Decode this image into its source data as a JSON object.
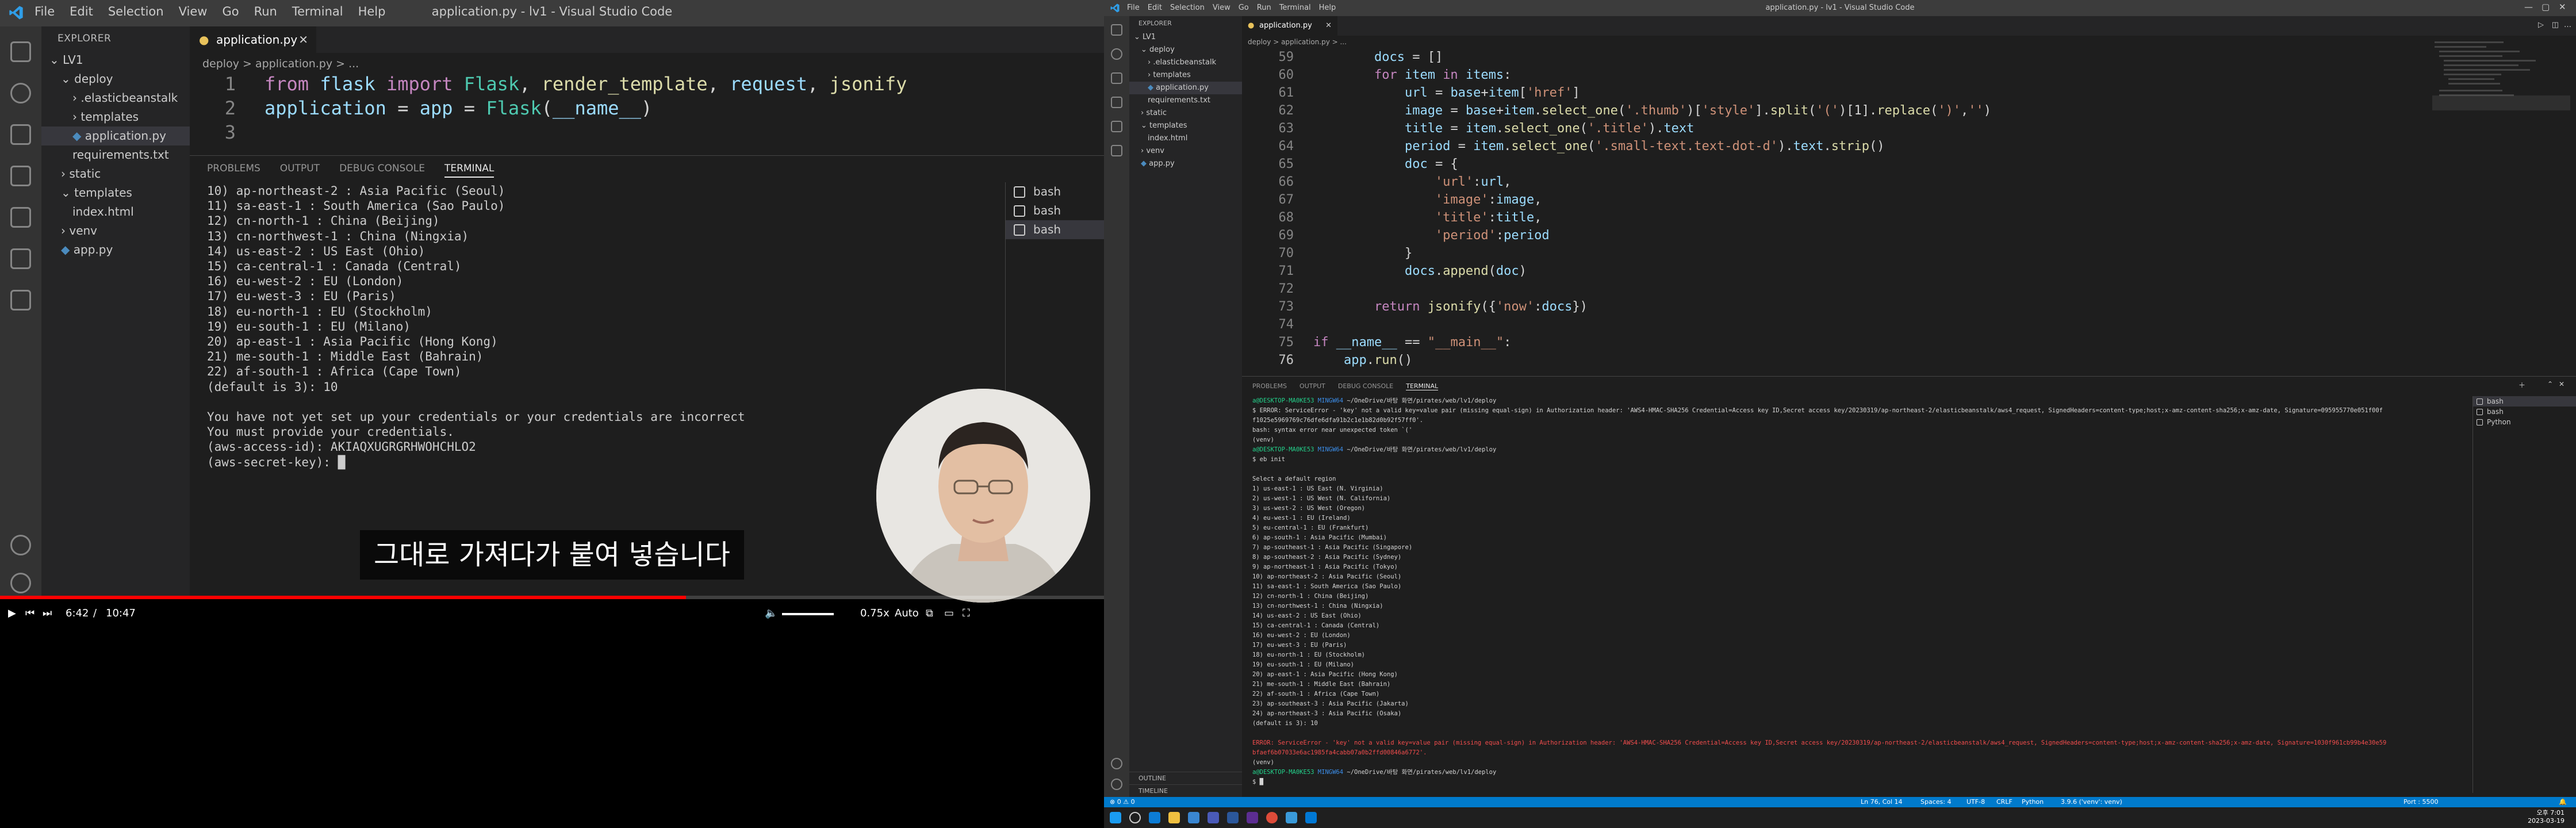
{
  "video": {
    "window_title": "application.py - lv1 - Visual Studio Code",
    "menu": [
      "File",
      "Edit",
      "Selection",
      "View",
      "Go",
      "Run",
      "Terminal",
      "Help"
    ],
    "explorer_header": "EXPLORER",
    "explorer": [
      {
        "label": "LV1",
        "indent": 0,
        "arrow": "v",
        "folder": true
      },
      {
        "label": "deploy",
        "indent": 1,
        "arrow": "v",
        "folder": true
      },
      {
        "label": ".elasticbeanstalk",
        "indent": 2,
        "arrow": ">",
        "folder": true
      },
      {
        "label": "templates",
        "indent": 2,
        "arrow": ">",
        "folder": true
      },
      {
        "label": "application.py",
        "indent": 2,
        "arrow": "",
        "folder": false,
        "selected": true
      },
      {
        "label": "requirements.txt",
        "indent": 2,
        "arrow": "",
        "folder": false
      },
      {
        "label": "static",
        "indent": 1,
        "arrow": ">",
        "folder": true
      },
      {
        "label": "templates",
        "indent": 1,
        "arrow": "v",
        "folder": true
      },
      {
        "label": "index.html",
        "indent": 2,
        "arrow": "",
        "folder": false
      },
      {
        "label": "venv",
        "indent": 1,
        "arrow": ">",
        "folder": true
      },
      {
        "label": "app.py",
        "indent": 1,
        "arrow": "",
        "folder": false
      }
    ],
    "tab_label": "application.py",
    "breadcrumb": "deploy  >  application.py  > ...",
    "code": [
      {
        "n": "1",
        "parts": [
          [
            "kw",
            "from "
          ],
          [
            "vr",
            "flask "
          ],
          [
            "kw",
            "import "
          ],
          [
            "tp",
            "Flask"
          ],
          [
            "df",
            ", "
          ],
          [
            "fn",
            "render_template"
          ],
          [
            "df",
            ", "
          ],
          [
            "vr",
            "request"
          ],
          [
            "df",
            ", "
          ],
          [
            "fn",
            "jsonify"
          ]
        ]
      },
      {
        "n": "2",
        "parts": [
          [
            "vr",
            "application "
          ],
          [
            "df",
            "= "
          ],
          [
            "vr",
            "app "
          ],
          [
            "df",
            "= "
          ],
          [
            "tp",
            "Flask"
          ],
          [
            "df",
            "("
          ],
          [
            "vr",
            "__name__"
          ],
          [
            "df",
            ")"
          ]
        ]
      },
      {
        "n": "3",
        "parts": []
      }
    ],
    "panel_tabs": [
      "PROBLEMS",
      "OUTPUT",
      "DEBUG CONSOLE",
      "TERMINAL"
    ],
    "terminal": [
      "10) ap-northeast-2 : Asia Pacific (Seoul)",
      "11) sa-east-1 : South America (Sao Paulo)",
      "12) cn-north-1 : China (Beijing)",
      "13) cn-northwest-1 : China (Ningxia)",
      "14) us-east-2 : US East (Ohio)",
      "15) ca-central-1 : Canada (Central)",
      "16) eu-west-2 : EU (London)",
      "17) eu-west-3 : EU (Paris)",
      "18) eu-north-1 : EU (Stockholm)",
      "19) eu-south-1 : EU (Milano)",
      "20) ap-east-1 : Asia Pacific (Hong Kong)",
      "21) me-south-1 : Middle East (Bahrain)",
      "22) af-south-1 : Africa (Cape Town)",
      "(default is 3): 10",
      "",
      "You have not yet set up your credentials or your credentials are incorrect",
      "You must provide your credentials.",
      "(aws-access-id): AKIAQXUGRGRHWOHCHLO2",
      "(aws-secret-key): █"
    ],
    "shells": [
      "bash",
      "bash",
      "bash"
    ],
    "caption": "그대로 가져다가 붙여 넣습니다",
    "time_current": "6:42",
    "time_sep": "/",
    "time_total": "10:47",
    "speed": "0.75x",
    "quality": "Auto",
    "progress": 0.6213
  },
  "vscode": {
    "window_title": "application.py - lv1 - Visual Studio Code",
    "menu": [
      "File",
      "Edit",
      "Selection",
      "View",
      "Go",
      "Run",
      "Terminal",
      "Help"
    ],
    "explorer_header": "EXPLORER",
    "explorer": [
      {
        "label": "LV1",
        "indent": 0,
        "arrow": "v"
      },
      {
        "label": "deploy",
        "indent": 1,
        "arrow": "v"
      },
      {
        "label": ".elasticbeanstalk",
        "indent": 2,
        "arrow": ">"
      },
      {
        "label": "templates",
        "indent": 2,
        "arrow": ">"
      },
      {
        "label": "application.py",
        "indent": 2,
        "arrow": "",
        "selected": true
      },
      {
        "label": "requirements.txt",
        "indent": 2,
        "arrow": ""
      },
      {
        "label": "static",
        "indent": 1,
        "arrow": ">"
      },
      {
        "label": "templates",
        "indent": 1,
        "arrow": "v"
      },
      {
        "label": "index.html",
        "indent": 2,
        "arrow": ""
      },
      {
        "label": "venv",
        "indent": 1,
        "arrow": ">"
      },
      {
        "label": "app.py",
        "indent": 1,
        "arrow": ""
      }
    ],
    "outline_label": "OUTLINE",
    "timeline_label": "TIMELINE",
    "tab_label": "application.py",
    "breadcrumb": "deploy  >  application.py  > ...",
    "code": [
      {
        "n": "59",
        "parts": [
          [
            "df",
            "        "
          ],
          [
            "vr",
            "docs "
          ],
          [
            "df",
            "= []"
          ]
        ]
      },
      {
        "n": "60",
        "parts": [
          [
            "df",
            "        "
          ],
          [
            "kw",
            "for "
          ],
          [
            "vr",
            "item "
          ],
          [
            "kw",
            "in "
          ],
          [
            "vr",
            "items"
          ],
          [
            "df",
            ":"
          ]
        ]
      },
      {
        "n": "61",
        "parts": [
          [
            "df",
            "            "
          ],
          [
            "vr",
            "url "
          ],
          [
            "df",
            "= "
          ],
          [
            "vr",
            "base"
          ],
          [
            "df",
            "+"
          ],
          [
            "vr",
            "item"
          ],
          [
            "df",
            "["
          ],
          [
            "st",
            "'href'"
          ],
          [
            "df",
            "]"
          ]
        ]
      },
      {
        "n": "62",
        "parts": [
          [
            "df",
            "            "
          ],
          [
            "vr",
            "image "
          ],
          [
            "df",
            "= "
          ],
          [
            "vr",
            "base"
          ],
          [
            "df",
            "+"
          ],
          [
            "vr",
            "item"
          ],
          [
            "df",
            "."
          ],
          [
            "fn",
            "select_one"
          ],
          [
            "df",
            "("
          ],
          [
            "st",
            "'.thumb'"
          ],
          [
            "df",
            ")["
          ],
          [
            "st",
            "'style'"
          ],
          [
            "df",
            "]."
          ],
          [
            "fn",
            "split"
          ],
          [
            "df",
            "("
          ],
          [
            "st",
            "'('"
          ],
          [
            "df",
            ")[1]."
          ],
          [
            "fn",
            "replace"
          ],
          [
            "df",
            "("
          ],
          [
            "st",
            "')'"
          ],
          [
            "df",
            ","
          ],
          [
            "st",
            "''"
          ],
          [
            "df",
            ")"
          ]
        ]
      },
      {
        "n": "63",
        "parts": [
          [
            "df",
            "            "
          ],
          [
            "vr",
            "title "
          ],
          [
            "df",
            "= "
          ],
          [
            "vr",
            "item"
          ],
          [
            "df",
            "."
          ],
          [
            "fn",
            "select_one"
          ],
          [
            "df",
            "("
          ],
          [
            "st",
            "'.title'"
          ],
          [
            "df",
            ")."
          ],
          [
            "vr",
            "text"
          ]
        ]
      },
      {
        "n": "64",
        "parts": [
          [
            "df",
            "            "
          ],
          [
            "vr",
            "period "
          ],
          [
            "df",
            "= "
          ],
          [
            "vr",
            "item"
          ],
          [
            "df",
            "."
          ],
          [
            "fn",
            "select_one"
          ],
          [
            "df",
            "("
          ],
          [
            "st",
            "'.small-text.text-dot-d'"
          ],
          [
            "df",
            ")."
          ],
          [
            "vr",
            "text"
          ],
          [
            "df",
            "."
          ],
          [
            "fn",
            "strip"
          ],
          [
            "df",
            "()"
          ]
        ]
      },
      {
        "n": "65",
        "parts": [
          [
            "df",
            "            "
          ],
          [
            "vr",
            "doc "
          ],
          [
            "df",
            "= {"
          ]
        ]
      },
      {
        "n": "66",
        "parts": [
          [
            "df",
            "                "
          ],
          [
            "st",
            "'url'"
          ],
          [
            "df",
            ":"
          ],
          [
            "vr",
            "url"
          ],
          [
            "df",
            ","
          ]
        ]
      },
      {
        "n": "67",
        "parts": [
          [
            "df",
            "                "
          ],
          [
            "st",
            "'image'"
          ],
          [
            "df",
            ":"
          ],
          [
            "vr",
            "image"
          ],
          [
            "df",
            ","
          ]
        ]
      },
      {
        "n": "68",
        "parts": [
          [
            "df",
            "                "
          ],
          [
            "st",
            "'title'"
          ],
          [
            "df",
            ":"
          ],
          [
            "vr",
            "title"
          ],
          [
            "df",
            ","
          ]
        ]
      },
      {
        "n": "69",
        "parts": [
          [
            "df",
            "                "
          ],
          [
            "st",
            "'period'"
          ],
          [
            "df",
            ":"
          ],
          [
            "vr",
            "period"
          ]
        ]
      },
      {
        "n": "70",
        "parts": [
          [
            "df",
            "            }"
          ]
        ]
      },
      {
        "n": "71",
        "parts": [
          [
            "df",
            "            "
          ],
          [
            "vr",
            "docs"
          ],
          [
            "df",
            "."
          ],
          [
            "fn",
            "append"
          ],
          [
            "df",
            "("
          ],
          [
            "vr",
            "doc"
          ],
          [
            "df",
            ")"
          ]
        ]
      },
      {
        "n": "72",
        "parts": []
      },
      {
        "n": "73",
        "parts": [
          [
            "df",
            "        "
          ],
          [
            "kw",
            "return "
          ],
          [
            "fn",
            "jsonify"
          ],
          [
            "df",
            "({"
          ],
          [
            "st",
            "'now'"
          ],
          [
            "df",
            ":"
          ],
          [
            "vr",
            "docs"
          ],
          [
            "df",
            "})"
          ]
        ]
      },
      {
        "n": "74",
        "parts": []
      },
      {
        "n": "75",
        "parts": [
          [
            "kw",
            "if "
          ],
          [
            "vr",
            "__name__ "
          ],
          [
            "df",
            "== "
          ],
          [
            "st",
            "\"__main__\""
          ],
          [
            "df",
            ":"
          ]
        ]
      },
      {
        "n": "76",
        "parts": [
          [
            "df",
            "    "
          ],
          [
            "vr",
            "app"
          ],
          [
            "df",
            "."
          ],
          [
            "fn",
            "run"
          ],
          [
            "df",
            "()"
          ]
        ]
      }
    ],
    "panel_tabs": [
      "PROBLEMS",
      "OUTPUT",
      "DEBUG CONSOLE",
      "TERMINAL"
    ],
    "terminal": [
      [
        [
          "g",
          "a@DESKTOP-MA0KE53 "
        ],
        [
          "b",
          "MINGW64 "
        ],
        [
          "df",
          "~/OneDrive/바탕 화면/pirates/web/lv1/deploy"
        ]
      ],
      [
        [
          "df",
          "$ ERROR: ServiceError - 'key' not a valid key=value pair (missing equal-sign) in Authorization header: 'AWS4-HMAC-SHA256 Credential=Access key ID,Secret access key/20230319/ap-northeast-2/elasticbeanstalk/aws4_request, SignedHeaders=content-type;host;x-amz-content-sha256;x-amz-date, Signature=095955770e051f00f"
        ]
      ],
      [
        [
          "df",
          "f1025e5969769c76dfe6dfa91b2c1e1b82d0b92f57ff0'."
        ]
      ],
      [
        [
          "df",
          "bash: syntax error near unexpected token `('"
        ]
      ],
      [
        [
          "df",
          "(venv)"
        ]
      ],
      [
        [
          "g",
          "a@DESKTOP-MA0KE53 "
        ],
        [
          "b",
          "MINGW64 "
        ],
        [
          "df",
          "~/OneDrive/바탕 화면/pirates/web/lv1/deploy"
        ]
      ],
      [
        [
          "df",
          "$ eb init"
        ]
      ],
      [
        [
          "df",
          ""
        ]
      ],
      [
        [
          "df",
          "Select a default region"
        ]
      ],
      [
        [
          "df",
          "1) us-east-1 : US East (N. Virginia)"
        ]
      ],
      [
        [
          "df",
          "2) us-west-1 : US West (N. California)"
        ]
      ],
      [
        [
          "df",
          "3) us-west-2 : US West (Oregon)"
        ]
      ],
      [
        [
          "df",
          "4) eu-west-1 : EU (Ireland)"
        ]
      ],
      [
        [
          "df",
          "5) eu-central-1 : EU (Frankfurt)"
        ]
      ],
      [
        [
          "df",
          "6) ap-south-1 : Asia Pacific (Mumbai)"
        ]
      ],
      [
        [
          "df",
          "7) ap-southeast-1 : Asia Pacific (Singapore)"
        ]
      ],
      [
        [
          "df",
          "8) ap-southeast-2 : Asia Pacific (Sydney)"
        ]
      ],
      [
        [
          "df",
          "9) ap-northeast-1 : Asia Pacific (Tokyo)"
        ]
      ],
      [
        [
          "df",
          "10) ap-northeast-2 : Asia Pacific (Seoul)"
        ]
      ],
      [
        [
          "df",
          "11) sa-east-1 : South America (Sao Paulo)"
        ]
      ],
      [
        [
          "df",
          "12) cn-north-1 : China (Beijing)"
        ]
      ],
      [
        [
          "df",
          "13) cn-northwest-1 : China (Ningxia)"
        ]
      ],
      [
        [
          "df",
          "14) us-east-2 : US East (Ohio)"
        ]
      ],
      [
        [
          "df",
          "15) ca-central-1 : Canada (Central)"
        ]
      ],
      [
        [
          "df",
          "16) eu-west-2 : EU (London)"
        ]
      ],
      [
        [
          "df",
          "17) eu-west-3 : EU (Paris)"
        ]
      ],
      [
        [
          "df",
          "18) eu-north-1 : EU (Stockholm)"
        ]
      ],
      [
        [
          "df",
          "19) eu-south-1 : EU (Milano)"
        ]
      ],
      [
        [
          "df",
          "20) ap-east-1 : Asia Pacific (Hong Kong)"
        ]
      ],
      [
        [
          "df",
          "21) me-south-1 : Middle East (Bahrain)"
        ]
      ],
      [
        [
          "df",
          "22) af-south-1 : Africa (Cape Town)"
        ]
      ],
      [
        [
          "df",
          "23) ap-southeast-3 : Asia Pacific (Jakarta)"
        ]
      ],
      [
        [
          "df",
          "24) ap-northeast-3 : Asia Pacific (Osaka)"
        ]
      ],
      [
        [
          "df",
          "(default is 3): 10"
        ]
      ],
      [
        [
          "df",
          ""
        ]
      ],
      [
        [
          "r",
          "ERROR: ServiceError - 'key' not a valid key=value pair (missing equal-sign) in Authorization header: 'AWS4-HMAC-SHA256 Credential=Access key ID,Secret access key/20230319/ap-northeast-2/elasticbeanstalk/aws4_request, SignedHeaders=content-type;host;x-amz-content-sha256;x-amz-date, Signature=1030f961cb99b4e30e59"
        ]
      ],
      [
        [
          "r",
          "bfaef6b07033e6ac1985fa4cabb07a0b2ffd00846a6772'."
        ]
      ],
      [
        [
          "df",
          "(venv)"
        ]
      ],
      [
        [
          "g",
          "a@DESKTOP-MA0KE53 "
        ],
        [
          "b",
          "MINGW64 "
        ],
        [
          "df",
          "~/OneDrive/바탕 화면/pirates/web/lv1/deploy"
        ]
      ],
      [
        [
          "df",
          "$ █"
        ]
      ]
    ],
    "shells": [
      "bash",
      "bash",
      "Python"
    ],
    "status": {
      "branch": "⊗ 0 ⚠ 0",
      "position": "Ln 76, Col 14",
      "spaces": "Spaces: 4",
      "encoding": "UTF-8",
      "eol": "CRLF",
      "language": "Python",
      "interpreter": "3.9.6 ('venv': venv)",
      "port": "Port : 5500"
    },
    "clock": {
      "time": "오후 7:01",
      "date": "2023-03-19"
    }
  }
}
